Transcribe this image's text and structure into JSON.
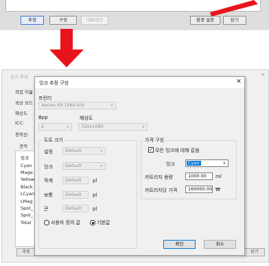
{
  "top_buttons": {
    "estimate": "추정",
    "config": "구성",
    "export": "내보내기",
    "env_settings": "환경 설정",
    "close": "닫기"
  },
  "bg_dialog": {
    "title": "잉크 추정",
    "labels": [
      "작업 이름",
      "색상 모드",
      "해상도",
      "ICC:",
      "용락선:"
    ],
    "estimate_label": "견적",
    "list_items": [
      "잉크",
      "Cyan",
      "Mage",
      "Yellow",
      "Black",
      "LCyan",
      "LMag",
      "Spot_",
      "Spot_",
      "Total"
    ],
    "bottom_left_button": "추정",
    "bottom_right_button": "닫기"
  },
  "dialog": {
    "title": "잉크 추정 구성",
    "printer_label": "프린터",
    "printer_value": "Xerion XP-1080-V/V",
    "bpp_label": "Bpp",
    "bpp_value": "2",
    "resolution_label": "해상도",
    "resolution_value": "720x1080",
    "dot_group_label": "도트 크기",
    "setting_label": "설정",
    "setting_value": "Default",
    "ink_label": "잉크",
    "ink_value": "Default",
    "small_label": "작게",
    "small_value": "Default",
    "normal_label": "보통",
    "normal_value": "Default",
    "large_label": "큰",
    "large_value": "Default",
    "unit": "pl",
    "radio_custom": "사용자 정의 값",
    "radio_default": "기본값",
    "price_group_label": "가격 구성",
    "all_inks_checkbox": "모든 잉크에 대해 같음",
    "price_ink_label": "잉크",
    "price_ink_value": "Cyan",
    "cartridge_capacity_label": "카트리지 용량",
    "cartridge_capacity_value": "1000.00",
    "cartridge_capacity_unit": "ml",
    "cartridge_price_label": "카트리지당 가격",
    "cartridge_price_value": "160000.00",
    "cartridge_price_unit": "₩",
    "ok_button": "확인",
    "cancel_button": "취소"
  },
  "colors": {
    "arrow": "#e8141b",
    "selection": "#0078d7"
  }
}
